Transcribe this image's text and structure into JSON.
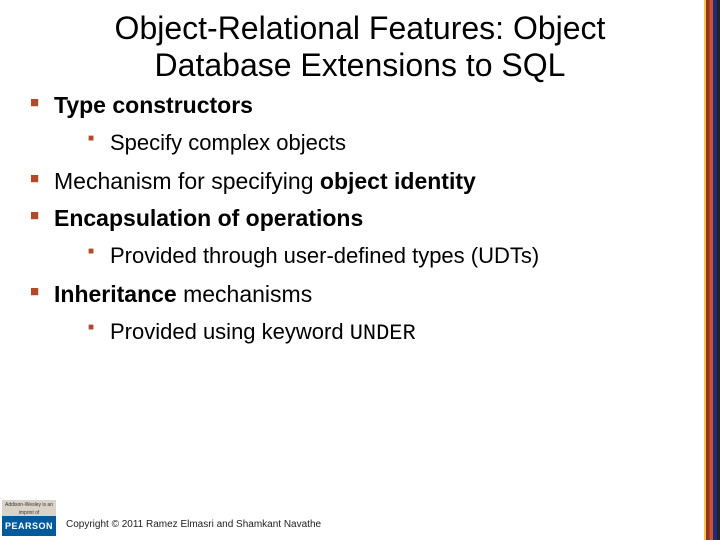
{
  "title": "Object-Relational Features: Object Database Extensions to SQL",
  "bullets": {
    "b1": "Type constructors",
    "b1a": "Specify complex objects",
    "b2_pre": "Mechanism for specifying ",
    "b2_em": "object identity",
    "b3": "Encapsulation of operations",
    "b3a": "Provided through user-defined types (UDTs)",
    "b4_em": "Inheritance",
    "b4_post": " mechanisms",
    "b4a_pre": "Provided using keyword ",
    "b4a_code": "UNDER"
  },
  "footer": {
    "logo_top": "Addison-Wesley is an imprint of",
    "logo_bottom": "PEARSON",
    "copyright": "Copyright © 2011 Ramez Elmasri and Shamkant Navathe"
  }
}
